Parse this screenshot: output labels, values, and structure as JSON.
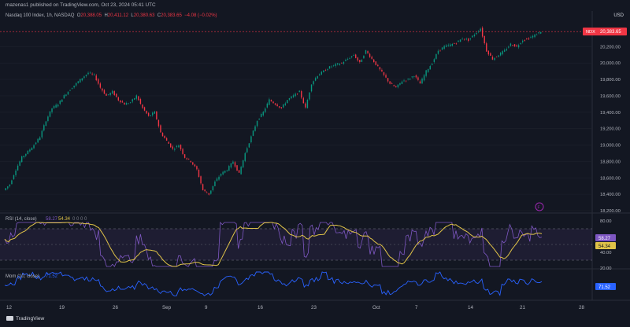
{
  "header": {
    "publisher": "mazenas1 published on TradingView.com, Oct 23, 2024 05:41 UTC"
  },
  "legend": {
    "symbol": "Nasdaq 100 Index, 1h, NASDAQ",
    "o_label": "O",
    "o_value": "20,388.05",
    "h_label": "H",
    "h_value": "20,411.12",
    "l_label": "L",
    "l_value": "20,380.63",
    "c_label": "C",
    "c_value": "20,383.65",
    "change": "−4.08 (−0.02%)"
  },
  "currency": "USD",
  "price_axis": {
    "ticks": [
      "20,200.00",
      "20,000.00",
      "19,800.00",
      "19,600.00",
      "19,400.00",
      "19,200.00",
      "19,000.00",
      "18,800.00",
      "18,600.00",
      "18,400.00",
      "18,200.00"
    ],
    "last_tag": "NDX",
    "last_price": "20,383.65"
  },
  "rsi_panel": {
    "label": "RSI (14, close)",
    "value1": "58.27",
    "value2": "54.34",
    "extra": "0  0  0  0",
    "ticks": [
      "80.00",
      "60.00",
      "40.00",
      "20.00"
    ],
    "tag1": "58.27",
    "tag2": "54.34"
  },
  "mom_panel": {
    "label": "Mom (10, close)",
    "value": "71.52",
    "tag": "71.52"
  },
  "x_axis": {
    "labels": [
      "12",
      "19",
      "26",
      "Sep",
      "9",
      "16",
      "23",
      "Oct",
      "7",
      "14",
      "21",
      "28"
    ]
  },
  "footer": {
    "brand": "TradingView"
  },
  "chart_data": {
    "type": "candlestick",
    "symbol": "Nasdaq 100 Index, 1h, NASDAQ",
    "ylim": [
      18200,
      20500
    ],
    "x_dates": [
      "Aug 12",
      "Aug 19",
      "Aug 26",
      "Sep",
      "Sep 9",
      "Sep 16",
      "Sep 23",
      "Oct",
      "Oct 7",
      "Oct 14",
      "Oct 21",
      "Oct 28"
    ],
    "close_path": [
      18450,
      18520,
      18700,
      18850,
      18920,
      19000,
      19100,
      19300,
      19450,
      19500,
      19600,
      19680,
      19750,
      19820,
      19880,
      19850,
      19700,
      19600,
      19650,
      19550,
      19500,
      19520,
      19600,
      19450,
      19350,
      19400,
      19150,
      19050,
      18950,
      19000,
      18850,
      18800,
      18700,
      18450,
      18400,
      18550,
      18650,
      18700,
      18800,
      18650,
      18900,
      19100,
      19300,
      19400,
      19550,
      19500,
      19450,
      19550,
      19600,
      19650,
      19450,
      19750,
      19850,
      19900,
      19950,
      19980,
      20000,
      20050,
      20100,
      20000,
      20150,
      20050,
      19950,
      19850,
      19750,
      19700,
      19780,
      19800,
      19850,
      19750,
      19900,
      20000,
      20150,
      20200,
      20220,
      20250,
      20300,
      20280,
      20350,
      20420,
      20150,
      20050,
      20100,
      20150,
      20230,
      20200,
      20280,
      20300,
      20340,
      20384
    ],
    "rsi": {
      "overbought": 70,
      "oversold": 30,
      "last": 58.27,
      "ma_last": 54.34,
      "ylim": [
        20,
        80
      ]
    },
    "mom": {
      "last": 71.52
    }
  }
}
